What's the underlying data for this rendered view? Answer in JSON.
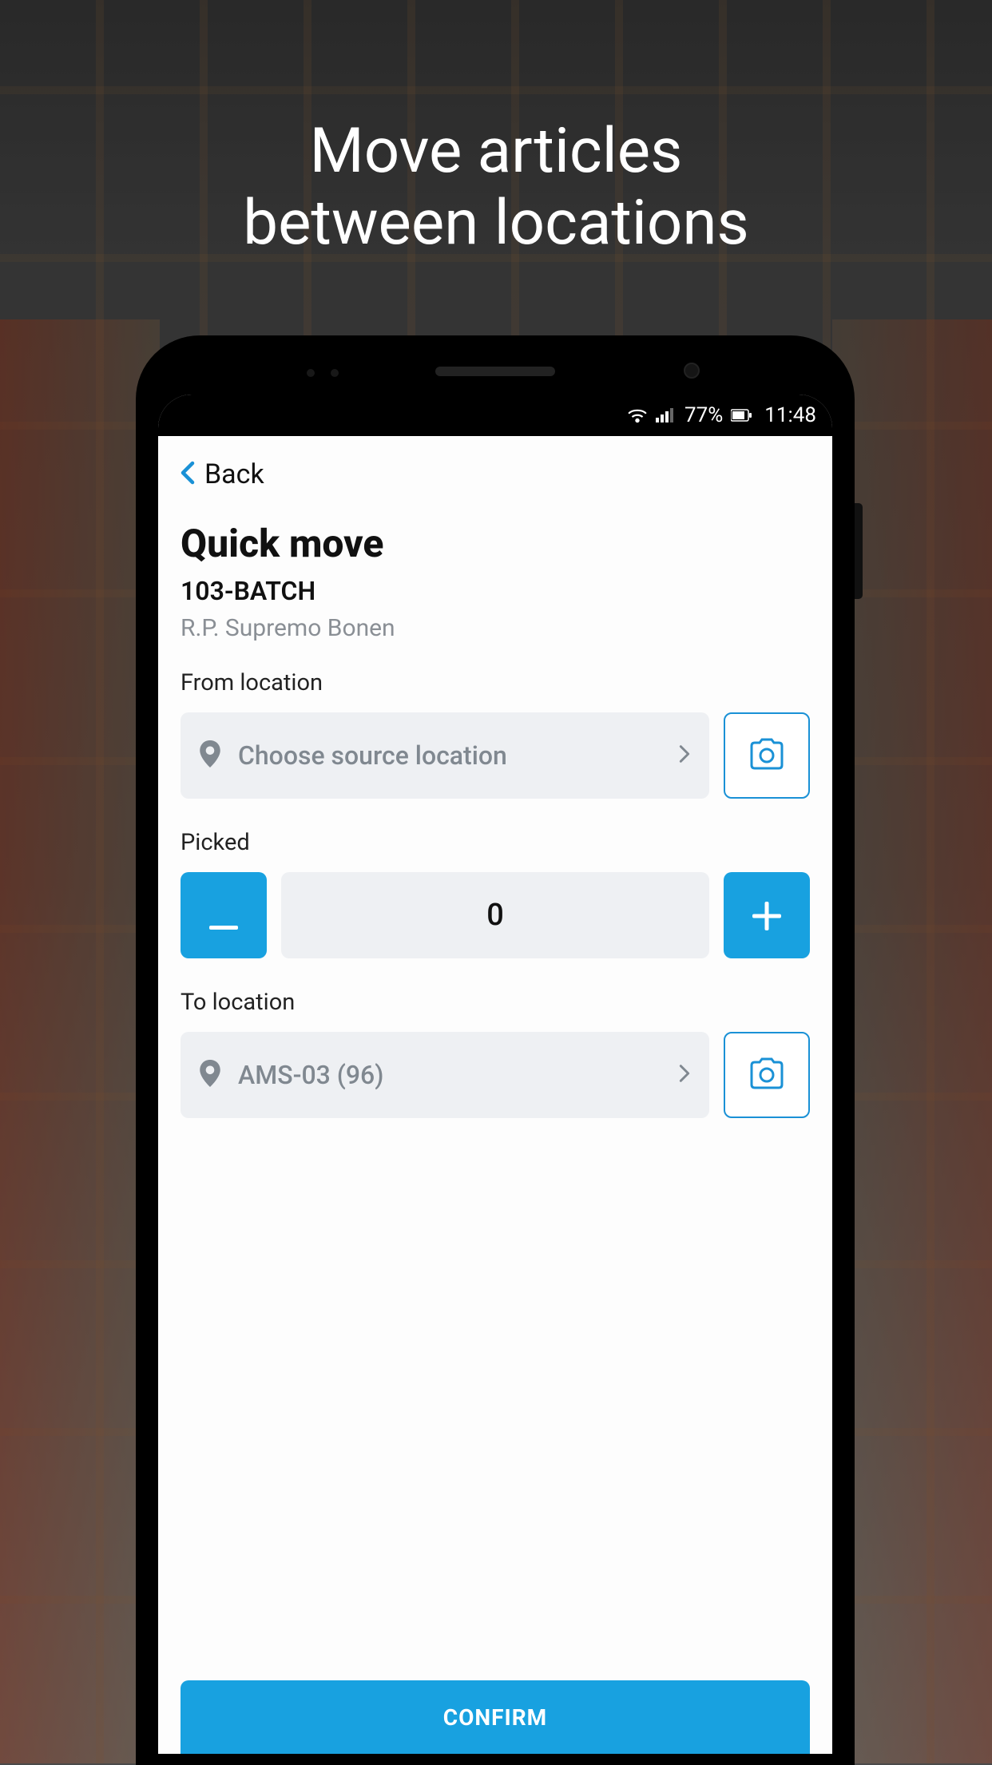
{
  "promo": {
    "line1": "Move articles",
    "line2": "between locations"
  },
  "statusBar": {
    "battery": "77%",
    "time": "11:48"
  },
  "nav": {
    "back_label": "Back"
  },
  "page": {
    "title": "Quick move",
    "batch_id": "103-BATCH",
    "item_name": "R.P. Supremo Bonen"
  },
  "from_location": {
    "label": "From location",
    "placeholder": "Choose source location"
  },
  "picked": {
    "label": "Picked",
    "value": "0"
  },
  "to_location": {
    "label": "To location",
    "value": "AMS-03 (96)"
  },
  "actions": {
    "confirm": "CONFIRM"
  },
  "icons": {
    "pin": "pin-icon",
    "camera": "camera-icon",
    "chevron_left": "chevron-left-icon",
    "chevron_right": "chevron-right-icon",
    "minus": "minus-icon",
    "plus": "plus-icon",
    "wifi": "wifi-icon",
    "signal": "signal-icon",
    "battery": "battery-icon"
  },
  "colors": {
    "accent": "#18a1e0",
    "muted_bg": "#eef0f3",
    "text_muted": "#8a8f95"
  }
}
